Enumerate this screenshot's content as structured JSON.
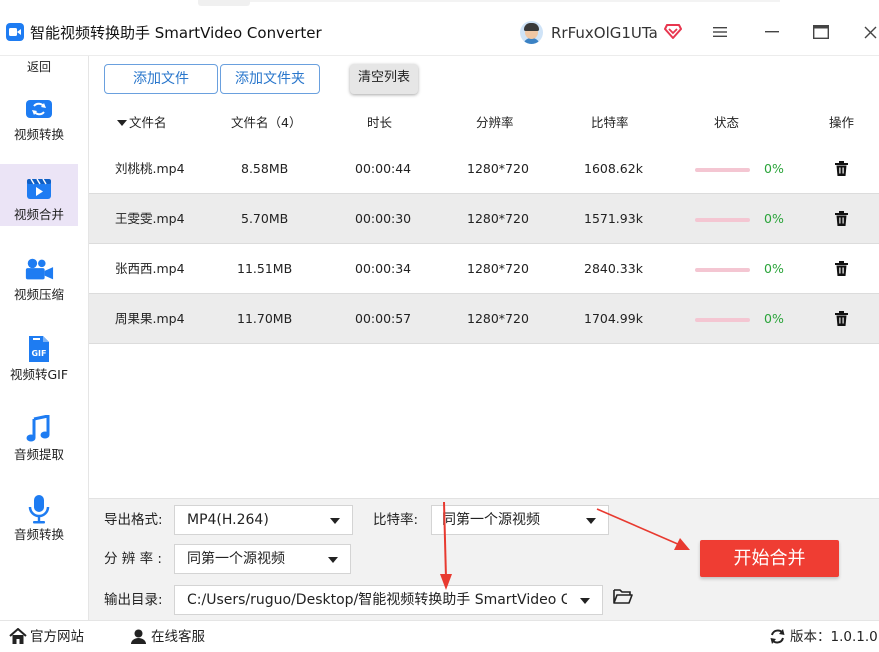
{
  "app": {
    "title": "智能视频转换助手 SmartVideo Converter",
    "username": "RrFuxOlG1UTa"
  },
  "colors": {
    "accent": "#1e7cf2",
    "active_nav_bg": "#ebe4f6",
    "start_button": "#ef3d33",
    "percent_text": "#2aa43a",
    "arrow": "#e83a30"
  },
  "sidebar": {
    "back_label": "返回",
    "items": [
      {
        "label": "视频转换",
        "icon": "video-convert-icon",
        "active": false
      },
      {
        "label": "视频合并",
        "icon": "video-merge-icon",
        "active": true
      },
      {
        "label": "视频压缩",
        "icon": "video-compress-icon",
        "active": false
      },
      {
        "label": "视频转GIF",
        "icon": "gif-icon",
        "active": false
      },
      {
        "label": "音频提取",
        "icon": "music-note-icon",
        "active": false
      },
      {
        "label": "音频转换",
        "icon": "microphone-icon",
        "active": false
      }
    ]
  },
  "toolbar": {
    "add_file": "添加文件",
    "add_folder": "添加文件夹",
    "clear_list": "清空列表"
  },
  "table": {
    "headers": {
      "name": "文件名",
      "size": "文件名（4）",
      "duration": "时长",
      "resolution": "分辨率",
      "bitrate": "比特率",
      "status": "状态",
      "action": "操作"
    },
    "rows": [
      {
        "name": "刘桃桃.mp4",
        "size": "8.58MB",
        "duration": "00:00:44",
        "resolution": "1280*720",
        "bitrate": "1608.62k",
        "progress": 0,
        "percent": "0%"
      },
      {
        "name": "王雯雯.mp4",
        "size": "5.70MB",
        "duration": "00:00:30",
        "resolution": "1280*720",
        "bitrate": "1571.93k",
        "progress": 0,
        "percent": "0%"
      },
      {
        "name": "张西西.mp4",
        "size": "11.51MB",
        "duration": "00:00:34",
        "resolution": "1280*720",
        "bitrate": "2840.33k",
        "progress": 0,
        "percent": "0%"
      },
      {
        "name": "周果果.mp4",
        "size": "11.70MB",
        "duration": "00:00:57",
        "resolution": "1280*720",
        "bitrate": "1704.99k",
        "progress": 0,
        "percent": "0%"
      }
    ]
  },
  "settings": {
    "format_label": "导出格式:",
    "format_value": "MP4(H.264)",
    "bitrate_label": "比特率:",
    "bitrate_value": "同第一个源视频",
    "resolution_label": "分 辨 率 :",
    "resolution_value": "同第一个源视频",
    "output_label": "输出目录:",
    "output_value": "C:/Users/ruguo/Desktop/智能视频转换助手 SmartVideo Converter",
    "start_button": "开始合并"
  },
  "footer": {
    "website": "官方网站",
    "support": "在线客服",
    "version": "版本：1.0.1.0"
  }
}
